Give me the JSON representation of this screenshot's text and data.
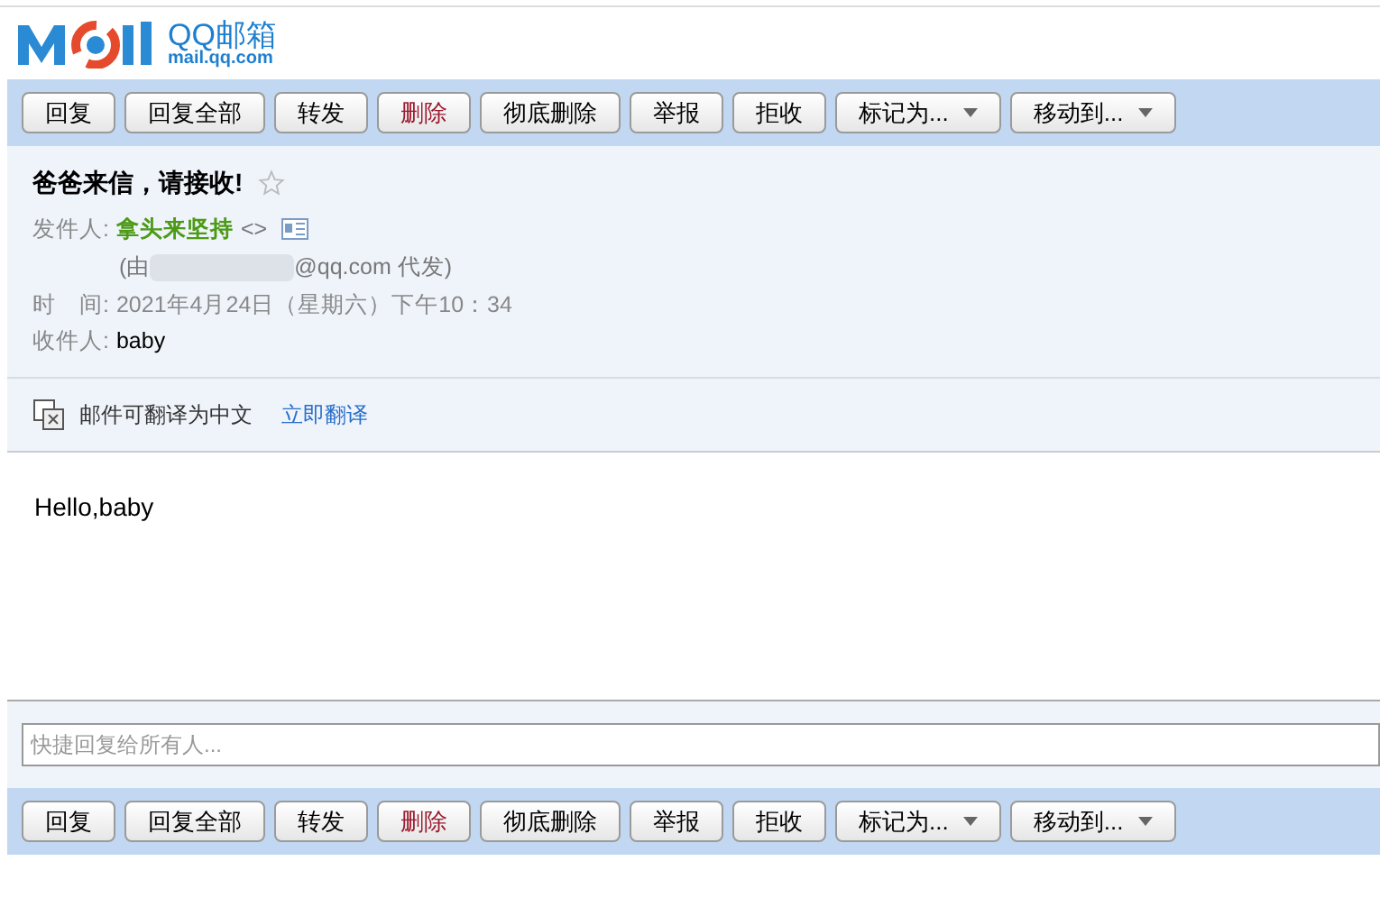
{
  "logo": {
    "brand": "QQ邮箱",
    "domain": "mail.qq.com"
  },
  "toolbar_top": [
    {
      "label": "回复",
      "kind": "plain"
    },
    {
      "label": "回复全部",
      "kind": "plain"
    },
    {
      "label": "转发",
      "kind": "plain"
    },
    {
      "label": "删除",
      "kind": "danger"
    },
    {
      "label": "彻底删除",
      "kind": "plain"
    },
    {
      "label": "举报",
      "kind": "plain"
    },
    {
      "label": "拒收",
      "kind": "plain"
    },
    {
      "label": "标记为...",
      "kind": "menu"
    },
    {
      "label": "移动到...",
      "kind": "menu"
    }
  ],
  "header": {
    "subject": "爸爸来信，请接收!",
    "starred": false,
    "sender_label": "发件人:",
    "sender_name": "拿头来坚持",
    "sender_address": "<>",
    "proxy_prefix": "(由",
    "proxy_suffix": "@qq.com 代发)",
    "time_label": "时　间:",
    "time": "2021年4月24日（星期六）下午10：34",
    "recipient_label": "收件人:",
    "recipient": "baby"
  },
  "translate": {
    "text": "邮件可翻译为中文",
    "link": "立即翻译"
  },
  "body": "Hello,baby",
  "quick_reply": {
    "placeholder": "快捷回复给所有人..."
  },
  "toolbar_bottom": [
    {
      "label": "回复",
      "kind": "plain"
    },
    {
      "label": "回复全部",
      "kind": "plain"
    },
    {
      "label": "转发",
      "kind": "plain"
    },
    {
      "label": "删除",
      "kind": "danger"
    },
    {
      "label": "彻底删除",
      "kind": "plain"
    },
    {
      "label": "举报",
      "kind": "plain"
    },
    {
      "label": "拒收",
      "kind": "plain"
    },
    {
      "label": "标记为...",
      "kind": "menu"
    },
    {
      "label": "移动到...",
      "kind": "menu"
    }
  ]
}
